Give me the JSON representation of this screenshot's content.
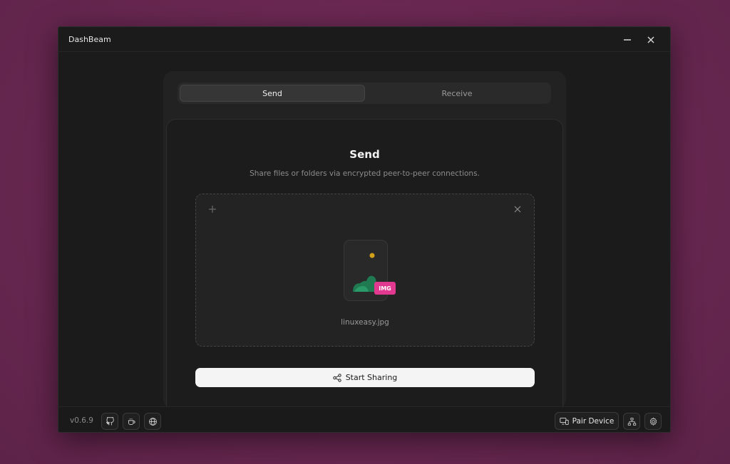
{
  "window": {
    "title": "DashBeam",
    "controls": {
      "minimize_icon": "minimize-icon",
      "close_icon": "close-icon"
    }
  },
  "tabs": [
    {
      "label": "Send",
      "active": true
    },
    {
      "label": "Receive",
      "active": false
    }
  ],
  "send_panel": {
    "title": "Send",
    "subtitle": "Share files or folders via encrypted peer-to-peer connections.",
    "dropzone": {
      "add_icon": "plus-icon",
      "clear_icon": "close-icon",
      "file": {
        "name": "linuxeasy.jpg",
        "badge": "IMG",
        "icon": "image-file-icon"
      }
    },
    "start_button": {
      "label": "Start Sharing",
      "icon": "share-icon"
    }
  },
  "footer": {
    "version": "v0.6.9",
    "left_buttons": [
      {
        "icon": "github-icon"
      },
      {
        "icon": "coffee-icon"
      },
      {
        "icon": "globe-icon"
      }
    ],
    "pair_button": {
      "label": "Pair Device",
      "icon": "devices-icon"
    },
    "right_buttons": [
      {
        "icon": "network-icon"
      },
      {
        "icon": "gear-icon"
      }
    ]
  },
  "colors": {
    "background": "#6a2852",
    "window": "#1b1b1b",
    "badge": "#e0398f",
    "image_green": "#1f7a52",
    "image_sun": "#d4a017",
    "button_primary": "#f4f4f4"
  }
}
